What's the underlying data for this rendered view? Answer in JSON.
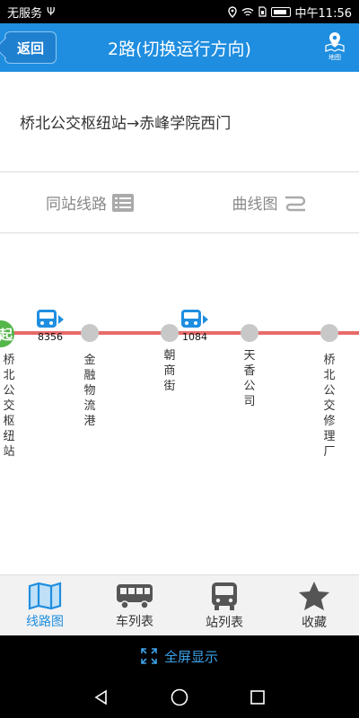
{
  "status_bar": {
    "carrier": "无服务",
    "usb_icon": "usb-icon",
    "time": "中午11:56"
  },
  "header": {
    "back_label": "返回",
    "title": "2路(切换运行方向)",
    "map_label": "地图"
  },
  "direction": {
    "text": "桥北公交枢纽站→赤峰学院西门"
  },
  "tabs": [
    {
      "label": "同站线路",
      "icon": "list-icon"
    },
    {
      "label": "曲线图",
      "icon": "curve-icon"
    }
  ],
  "route": {
    "start_badge": "起",
    "line_color": "#e86a6a",
    "stops": [
      {
        "name": "桥北公交枢纽站"
      },
      {
        "name": "金融物流港"
      },
      {
        "name": "朝商街"
      },
      {
        "name": "天香公司"
      },
      {
        "name": "桥北公交修理厂"
      }
    ],
    "buses": [
      {
        "label": "8356"
      },
      {
        "label": "1084"
      }
    ]
  },
  "bottom_nav": [
    {
      "label": "线路图",
      "icon": "map-icon",
      "active": true
    },
    {
      "label": "车列表",
      "icon": "bus-side-icon",
      "active": false
    },
    {
      "label": "站列表",
      "icon": "bus-front-icon",
      "active": false
    },
    {
      "label": "收藏",
      "icon": "star-icon",
      "active": false
    }
  ],
  "fullscreen": {
    "label": "全屏显示",
    "icon": "expand-icon"
  },
  "colors": {
    "accent": "#1f8ee0",
    "start_green": "#55b64a",
    "stop_gray": "#c8c8c8"
  }
}
